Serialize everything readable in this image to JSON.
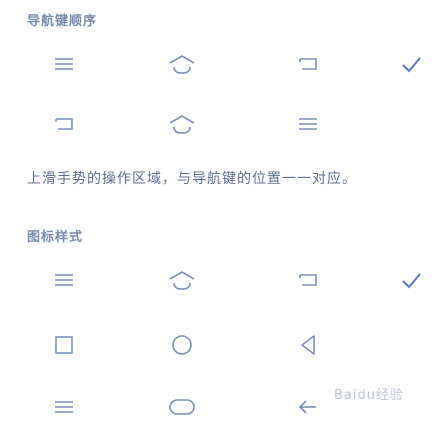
{
  "section1": {
    "title": "导航键顺序",
    "options": [
      {
        "name": "order-menu-home-back",
        "icons": [
          "menu-icon",
          "home-icon",
          "back-icon"
        ],
        "selected": true
      },
      {
        "name": "order-back-home-menu",
        "icons": [
          "back-icon",
          "home-icon",
          "menu-icon"
        ],
        "selected": false
      }
    ]
  },
  "description": "上滑手势的操作区域，与导航键的位置一一对应。",
  "section2": {
    "title": "图标样式",
    "options": [
      {
        "name": "style-default",
        "icons": [
          "menu-icon",
          "home-icon",
          "back-icon"
        ],
        "selected": true
      },
      {
        "name": "style-classic",
        "icons": [
          "square-icon",
          "circle-icon",
          "triangle-back-icon"
        ],
        "selected": false
      },
      {
        "name": "style-minimal",
        "icons": [
          "lines-icon",
          "pill-icon",
          "arrow-back-icon"
        ],
        "selected": false
      }
    ]
  },
  "watermark": {
    "text": "Baidu经验"
  },
  "colors": {
    "icon": "#7d8fb5",
    "check": "#5b78c9",
    "label": "#7a8bb0"
  }
}
